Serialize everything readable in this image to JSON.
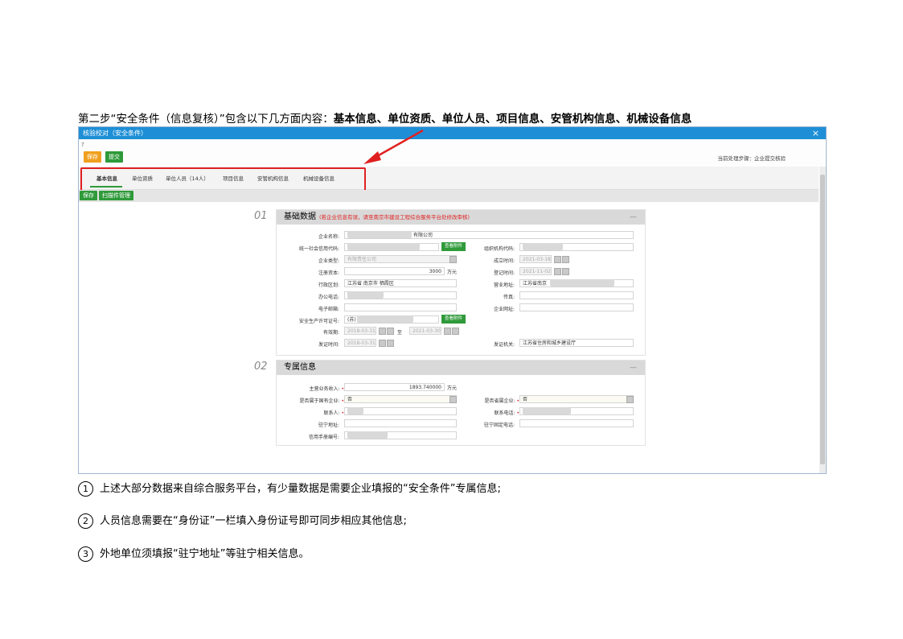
{
  "heading": {
    "prefix": "第二步“安全条件（信息复核）”包含以下几方面内容：",
    "bold": "基本信息、单位资质、单位人员、项目信息、安管机构信息、机械设备信息"
  },
  "window": {
    "title": "核验校对（安全条件）",
    "close": "×",
    "save_btn": "保存",
    "submit_btn": "提交",
    "current_step": "当前处理步骤：企业提交核验",
    "tabs": [
      "基本信息",
      "单位资质",
      "单位人员（14人）",
      "项目信息",
      "安管机构信息",
      "机械设备信息"
    ],
    "toolbar2_save": "保存",
    "toolbar2_attach": "扫描件管理"
  },
  "section1": {
    "num": "01",
    "title": "基础数据",
    "note": "(若企业信息有误，请至南京市建设工程综合服务平台处修改审核)",
    "fields": {
      "company_name_label": "企业名称:",
      "company_name_value": "有限公司",
      "credit_code_label": "统一社会信用代码:",
      "view_attach": "查看附件",
      "org_code_label": "组织机构代码:",
      "company_type_label": "企业类型:",
      "company_type_value": "有限责任公司",
      "founded_label": "成立时间:",
      "founded_value": "2021-03-18",
      "capital_label": "注册资本:",
      "capital_value": "3000",
      "capital_unit": "万元",
      "reg_date_label": "登记时间:",
      "reg_date_value": "2021-11-02",
      "region_label": "行政区划:",
      "region_value": "江苏省 南京市 栖霞区",
      "biz_addr_label": "营业地址:",
      "biz_addr_value": "江苏省南京",
      "phone_label": "办公电话:",
      "fax_label": "传真:",
      "email_label": "电子邮箱:",
      "website_label": "企业网址:",
      "license_label": "安全生产许可证号:",
      "license_value": "(苏)",
      "valid_label": "有效期:",
      "valid_from": "2018-03-31",
      "valid_to_sep": "至",
      "valid_to": "2021-03-30",
      "issue_date_label": "发证时间:",
      "issue_date_value": "2018-03-31",
      "issuer_label": "发证机关:",
      "issuer_value": "江苏省住房和城乡建设厅"
    }
  },
  "section2": {
    "num": "02",
    "title": "专属信息",
    "fields": {
      "income_label": "主营业务收入:",
      "income_value": "1893.740000",
      "income_unit": "万元",
      "state_owned_label": "是否属于国有企业:",
      "state_owned_value": "否",
      "provincial_label": "是否省属企业:",
      "provincial_value": "否",
      "contact_label": "联系人:",
      "contact_phone_label": "联系电话:",
      "local_addr_label": "驻宁地址:",
      "local_phone_label": "驻宁固定电话:",
      "credit_no_label": "信用手册编号:"
    }
  },
  "notes": [
    {
      "mark": "①",
      "text": "上述大部分数据来自综合服务平台，有少量数据是需要企业填报的“安全条件”专属信息;"
    },
    {
      "mark": "②",
      "text": "人员信息需要在“身份证”一栏填入身份证号即可同步相应其他信息;"
    },
    {
      "mark": "③",
      "text": "外地单位须填报“驻宁地址”等驻宁相关信息。"
    }
  ],
  "colors": {
    "accent": "#1e8fd6",
    "annotation": "#e02020",
    "button": "#2f9a3a",
    "button_orange": "#f0a020"
  }
}
